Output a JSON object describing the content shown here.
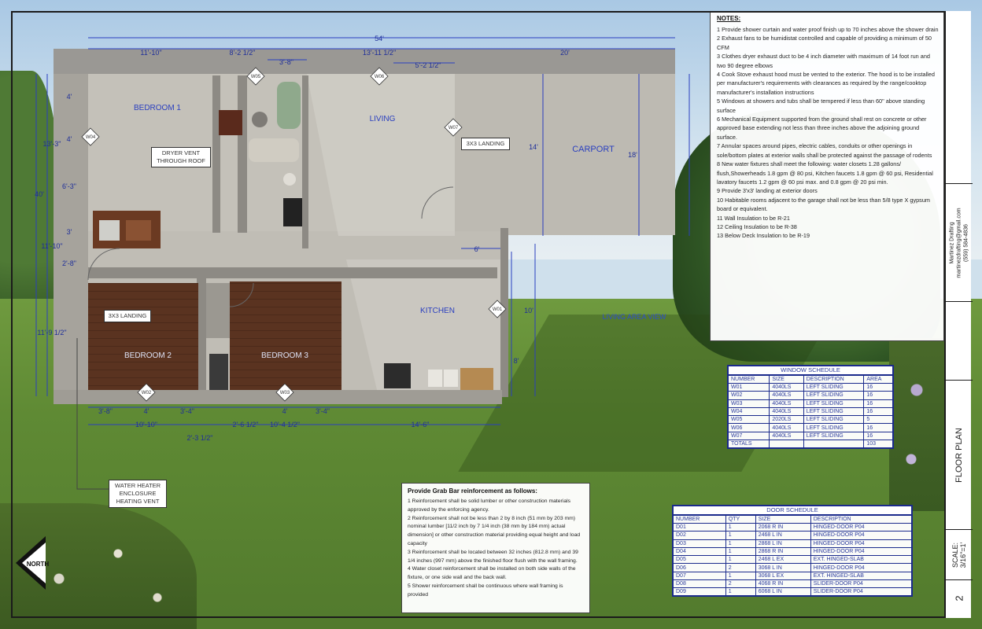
{
  "notes": {
    "title": "NOTES:",
    "items": [
      "1 Provide shower curtain and water proof finish up to 70 inches above the shower drain",
      "2 Exhaust fans to be humidistat controlled and capable of providing a minimum of 50 CFM",
      "3 Clothes dryer exhaust duct to be 4 inch diameter with maximum of 14 foot run and two 90 degree elbows",
      "4 Cook Stove exhaust hood must be vented to the exterior. The hood is to be installed per manufacturer's requirements with clearances as required by the range/cooktop manufacturer's installation instructions",
      "5 Windows at showers and tubs shall be tempered if less than 60\" above standing surface",
      "6 Mechanical Equipment supported from the ground shall rest on concrete or other approved base extending not less than three inches above the adjoining ground surface.",
      "7 Annular spaces around pipes, electric cables, conduits or other openings in sole/bottom plates at exterior walls shall be protected against the passage of rodents",
      "8 New water fixtures shall meet the following: water closets 1.28 gallons/ flush,Showerheads 1.8 gpm @ 80 psi, Kitchen faucets 1.8 gpm @ 60 psi, Residential lavatory faucets 1.2 gpm @ 60 psi max. and 0.8 gpm @ 20 psi min.",
      "9 Provide 3'x3' landing at exterior doors",
      "10 Habitable rooms adjacent to the garage shall not be less than 5/8 type X gypsum board or equivalent.",
      "11 Wall Insulation to be R-21",
      "12 Ceiling Insulation to be R-38",
      "13 Below Deck Insulation to be R-19"
    ]
  },
  "grab_bar": {
    "title": "Provide Grab Bar reinforcement as follows:",
    "items": [
      "1  Reinforcement shall be solid lumber or other construction materials approved by the enforcing agency.",
      "2  Reinforcement shall not be less than 2 by 8 inch (51 mm by 203 mm) nominal lumber [11/2 inch by 7 1/4 inch (38 mm by 184 mm) actual dimension] or other construction material providing equal height and load capacity",
      "3  Reinforcement shall be located between 32 inches (812.8 mm) and 39 1/4 inches (997 mm) above the finished floor flush with the wall framing.",
      "4  Water closet reinforcement shall be installed on both side walls of the fixture, or one side wall and the back wall.",
      "5  Shower reinforcement shall be continuous where wall framing is provided"
    ]
  },
  "window_schedule": {
    "title": "WINDOW SCHEDULE",
    "headers": [
      "NUMBER",
      "SIZE",
      "DESCRIPTION",
      "AREA"
    ],
    "rows": [
      [
        "W01",
        "4040LS",
        "LEFT SLIDING",
        "16"
      ],
      [
        "W02",
        "4040LS",
        "LEFT SLIDING",
        "16"
      ],
      [
        "W03",
        "4040LS",
        "LEFT SLIDING",
        "16"
      ],
      [
        "W04",
        "4040LS",
        "LEFT SLIDING",
        "16"
      ],
      [
        "W05",
        "2020LS",
        "LEFT SLIDING",
        "5"
      ],
      [
        "W06",
        "4040LS",
        "LEFT SLIDING",
        "16"
      ],
      [
        "W07",
        "4040LS",
        "LEFT SLIDING",
        "16"
      ]
    ],
    "totals_label": "TOTALS",
    "totals_value": "103"
  },
  "door_schedule": {
    "title": "DOOR SCHEDULE",
    "headers": [
      "NUMBER",
      "QTY",
      "SIZE",
      "DESCRIPTION"
    ],
    "rows": [
      [
        "D01",
        "1",
        "2068 R IN",
        "HINGED-DOOR P04"
      ],
      [
        "D02",
        "1",
        "2468 L IN",
        "HINGED-DOOR P04"
      ],
      [
        "D03",
        "1",
        "2868 L IN",
        "HINGED-DOOR P04"
      ],
      [
        "D04",
        "1",
        "2868 R IN",
        "HINGED-DOOR P04"
      ],
      [
        "D05",
        "1",
        "2468 L EX",
        "EXT. HINGED-SLAB"
      ],
      [
        "D06",
        "2",
        "3068 L IN",
        "HINGED-DOOR P04"
      ],
      [
        "D07",
        "1",
        "3068 L EX",
        "EXT. HINGED-SLAB"
      ],
      [
        "D08",
        "2",
        "4068 R IN",
        "SLIDER-DOOR P04"
      ],
      [
        "D09",
        "1",
        "6068 L IN",
        "SLIDER-DOOR P04"
      ]
    ]
  },
  "title_block": {
    "company": "Martinez Drafting",
    "email": "martinezdrafting@gmail.com",
    "phone": "(559) 584-4836",
    "sheet_title": "FLOOR PLAN",
    "scale_label": "SCALE:",
    "scale_value": "3/16\"=1'",
    "sheet_number": "2"
  },
  "rooms": {
    "bedroom1": "BEDROOM 1",
    "living": "LIVING",
    "carport": "CARPORT",
    "bedroom2": "BEDROOM 2",
    "bedroom3": "BEDROOM 3",
    "kitchen": "KITCHEN",
    "living_area_view": "LIVING AREA VIEW"
  },
  "callouts": {
    "dryer_vent": "DRYER VENT THROUGH ROOF",
    "landing_top": "3X3 LANDING",
    "landing_left": "3X3 LANDING",
    "water_heater": "WATER HEATER ENCLOSURE HEATING VENT",
    "north": "NORTH"
  },
  "dimensions": {
    "top_overall": "54'",
    "top_1": "11'-10\"",
    "top_2": "8'-2 1/2\"",
    "top_3": "3'-8\"",
    "top_4": "13'-11 1/2\"",
    "top_5": "20'",
    "top_6": "5'-2 1/2\"",
    "left_1": "4'",
    "left_2": "4'",
    "left_3": "6'-3\"",
    "left_4": "3'",
    "left_5": "2'-8\"",
    "left_6": "13'-3\"",
    "left_7": "11'-9 1/2\"",
    "left_overall": "40'",
    "left_8": "11'-10\"",
    "carport_14": "14'",
    "carport_18": "18'",
    "kitchen_10": "10'",
    "kitchen_8": "8'",
    "mid_6": "6'",
    "bot_1": "3'-8\"",
    "bot_2": "4'",
    "bot_3": "3'-4\"",
    "bot_4": "2'-6 1/2\"",
    "bot_5": "4'",
    "bot_6": "3'-4\"",
    "bot_7": "10'-10\"",
    "bot_8": "2'-3 1/2\"",
    "bot_9": "10'-4 1/2\"",
    "bot_10": "14'-6\""
  },
  "tags": {
    "w05": "W05",
    "w06": "W06",
    "w04": "W04",
    "w07": "W07",
    "w01": "W01",
    "w02": "W02",
    "w03": "W03"
  },
  "colors": {
    "dimension_blue": "#2a3fbf",
    "schedule_blue": "#1a2a8c",
    "wood": "#5a3320",
    "concrete": "#b9b6ae"
  }
}
